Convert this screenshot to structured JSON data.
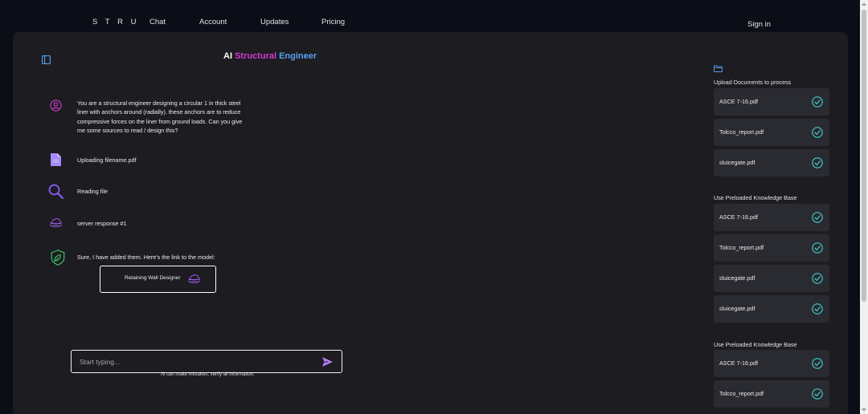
{
  "topnav": {
    "brand": "S T R U",
    "chat": "Chat",
    "account": "Account",
    "updates": "Updates",
    "pricing": "Pricing",
    "sign_in": "Sign in"
  },
  "header": {
    "title_ai": "AI",
    "title_structural": "Structural",
    "title_engineer": "Engineer"
  },
  "messages": [
    {
      "icon": "user-icon",
      "text": "You are a structural engineer designing a circular 1 in thick steel liner with anchors around (radially). these anchors are to reduce compressive forces on the liner from ground loads. Can you give me some sources to read / design this?"
    },
    {
      "icon": "file-icon",
      "text": "Uploading filename.pdf"
    },
    {
      "icon": "search-icon",
      "text": "Reading file"
    },
    {
      "icon": "cloud-hand-icon",
      "text": "server response #1"
    },
    {
      "icon": "leaf-shield-icon",
      "text": "Sure, I have added them. Here's the link to the model:"
    }
  ],
  "result_link": {
    "label": "Retaining Wall Designer"
  },
  "composer": {
    "placeholder": "Start typing...",
    "disclaimer": "Ai can make mistakes, verify all information."
  },
  "right_panel": {
    "sections": [
      {
        "title": "Upload Documents to process",
        "files": [
          "ASCE 7-16.pdf",
          "Tolcco_report.pdf",
          "sluicegate.pdf"
        ]
      },
      {
        "title": "Use Preloaded Knowledge Base",
        "files": [
          "ASCE 7-16.pdf",
          "Tolcco_report.pdf",
          "sluicegate.pdf",
          "sluicegate.pdf"
        ]
      },
      {
        "title": "Use Preloaded Knowledge Base",
        "files": [
          "ASCE 7-16.pdf",
          "Tolcco_report.pdf"
        ]
      }
    ]
  },
  "colors": {
    "page_bg": "#0b0d17",
    "panel_bg": "#1c1c21",
    "card_bg": "#2a2a31",
    "accent_magenta": "#d63ad0",
    "accent_blue": "#5aa0f0",
    "check_teal": "#3fd0d0",
    "icon_purple": "#a05cf0"
  }
}
